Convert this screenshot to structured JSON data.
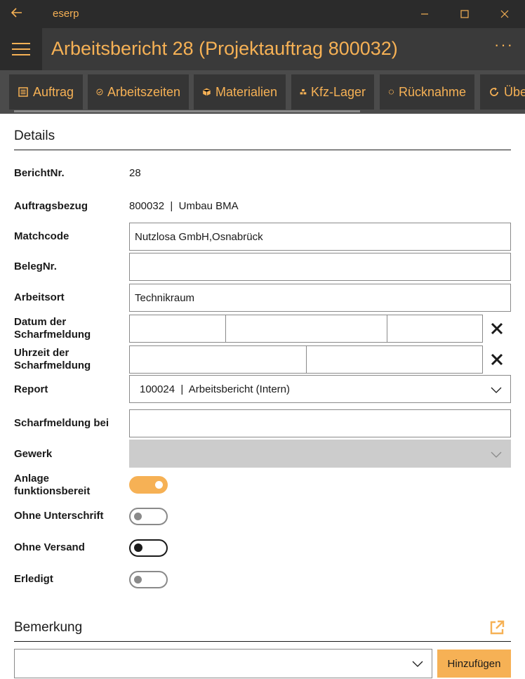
{
  "window": {
    "app_name": "eserp"
  },
  "header": {
    "title": "Arbeitsbericht 28 (Projektauftrag 800032)",
    "more_label": "···"
  },
  "toolbar": {
    "buttons": [
      {
        "label": "Auftrag",
        "icon": "list-icon"
      },
      {
        "label": "Arbeitszeiten",
        "icon": "clock-check-icon"
      },
      {
        "label": "Materialien",
        "icon": "box-icon"
      },
      {
        "label": "Kfz-Lager",
        "icon": "boxes-icon"
      },
      {
        "label": "Rücknahme",
        "icon": "spinner-icon"
      },
      {
        "label": "Übe",
        "icon": "refresh-icon"
      }
    ]
  },
  "details": {
    "section_title": "Details",
    "berichtnr": {
      "label": "BerichtNr.",
      "value": "28"
    },
    "auftragsbezug": {
      "label": "Auftragsbezug",
      "value": "800032  |  Umbau BMA"
    },
    "matchcode": {
      "label": "Matchcode",
      "value": "Nutzlosa GmbH,Osnabrück"
    },
    "belegnr": {
      "label": "BelegNr.",
      "value": ""
    },
    "arbeitsort": {
      "label": "Arbeitsort",
      "value": "Technikraum"
    },
    "datum_scharfmeldung": {
      "label": "Datum der Scharfmeldung",
      "day": "",
      "month": "",
      "year": ""
    },
    "uhrzeit_scharfmeldung": {
      "label": "Uhrzeit der Scharfmeldung",
      "hour": "",
      "minute": ""
    },
    "report": {
      "label": "Report",
      "value": "100024  |  Arbeitsbericht (Intern)"
    },
    "scharfmeldung_bei": {
      "label": "Scharfmeldung bei",
      "value": ""
    },
    "gewerk": {
      "label": "Gewerk",
      "value": ""
    },
    "anlage_funktionsbereit": {
      "label": "Anlage funktionsbereit",
      "on": true
    },
    "ohne_unterschrift": {
      "label": "Ohne Unterschrift",
      "on": false
    },
    "ohne_versand": {
      "label": "Ohne Versand",
      "on": false
    },
    "erledigt": {
      "label": "Erledigt",
      "on": false
    }
  },
  "bemerkung": {
    "section_title": "Bemerkung",
    "select_value": "",
    "add_label": "Hinzufügen"
  },
  "colors": {
    "accent": "#f6b155",
    "titlebar": "#2b2b2b",
    "header": "#3a3a3a",
    "toolbar": "#4b4b4b",
    "button": "#353535"
  }
}
